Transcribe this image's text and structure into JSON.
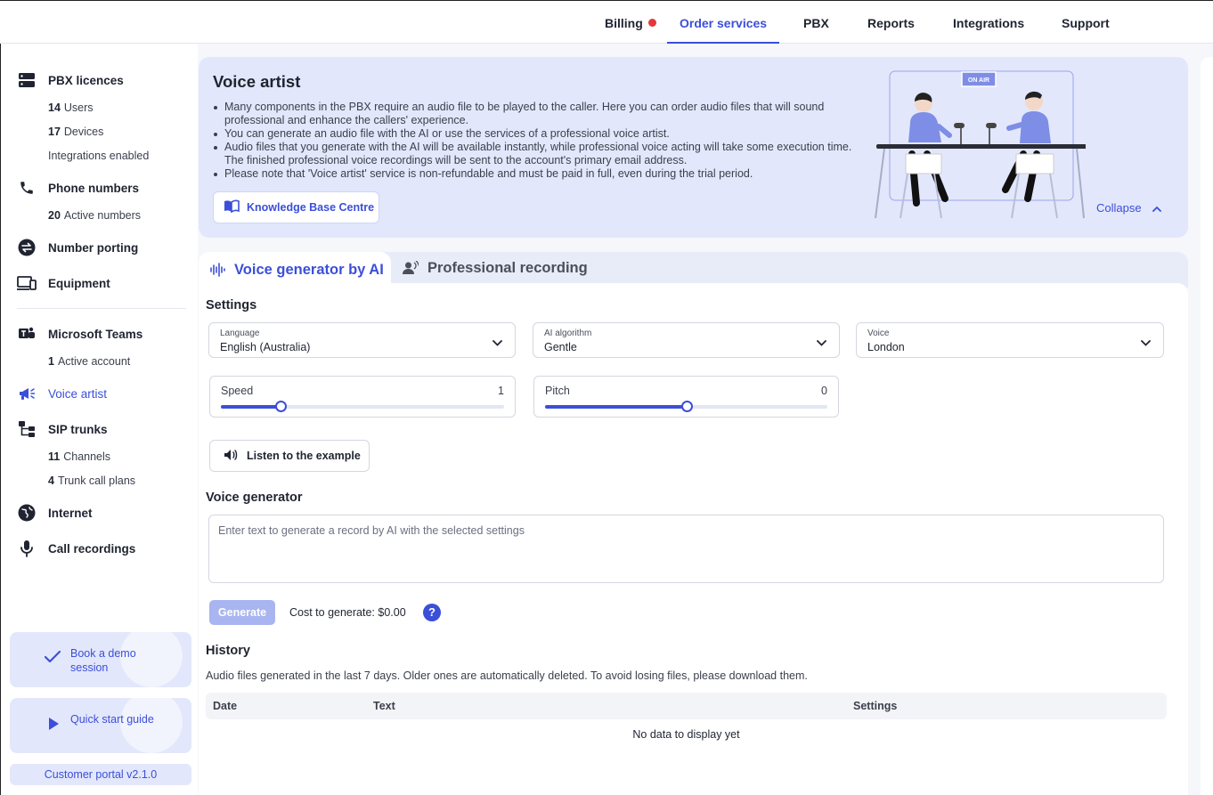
{
  "nav": {
    "items": [
      {
        "label": "Billing",
        "dot": true
      },
      {
        "label": "Order services",
        "active": true
      },
      {
        "label": "PBX"
      },
      {
        "label": "Reports"
      },
      {
        "label": "Integrations"
      },
      {
        "label": "Support"
      }
    ]
  },
  "sidebar": {
    "pbx": {
      "label": "PBX licences",
      "subs": [
        {
          "n": "14",
          "t": "Users"
        },
        {
          "n": "17",
          "t": "Devices"
        },
        {
          "n": "",
          "t": "Integrations enabled"
        }
      ]
    },
    "phone": {
      "label": "Phone numbers",
      "subs": [
        {
          "n": "20",
          "t": "Active numbers"
        }
      ]
    },
    "porting": {
      "label": "Number porting"
    },
    "equipment": {
      "label": "Equipment"
    },
    "teams": {
      "label": "Microsoft Teams",
      "subs": [
        {
          "n": "1",
          "t": "Active account"
        }
      ]
    },
    "voice": {
      "label": "Voice artist"
    },
    "sip": {
      "label": "SIP trunks",
      "subs": [
        {
          "n": "11",
          "t": "Channels"
        },
        {
          "n": "4",
          "t": "Trunk call plans"
        }
      ]
    },
    "internet": {
      "label": "Internet"
    },
    "recordings": {
      "label": "Call recordings"
    },
    "demo": "Book a demo session",
    "guide": "Quick start guide",
    "version": "Customer portal v2.1.0"
  },
  "banner": {
    "title": "Voice artist",
    "bullets": [
      "Many components in the PBX require an audio file to be played to the caller. Here you can order audio files that will sound professional and enhance the callers' experience.",
      "You can generate an audio file with the AI or use the services of a professional voice artist.",
      "Audio files that you generate with the AI will be available instantly, while professional voice acting will take some execution time. The finished professional voice recordings will be sent to the account's primary email address.",
      "Please note that 'Voice artist' service is non-refundable and must be paid in full, even during the trial period."
    ],
    "kb_button": "Knowledge Base Centre",
    "collapse": "Collapse",
    "on_air": "ON AIR"
  },
  "tabs": {
    "ai": "Voice generator by AI",
    "pro": "Professional recording"
  },
  "settings": {
    "title": "Settings",
    "language": {
      "label": "Language",
      "value": "English (Australia)"
    },
    "algorithm": {
      "label": "AI algorithm",
      "value": "Gentle"
    },
    "voice": {
      "label": "Voice",
      "value": "London"
    },
    "speed": {
      "label": "Speed",
      "value": "1",
      "level": 0.21
    },
    "pitch": {
      "label": "Pitch",
      "value": "0",
      "level": 0.5
    },
    "listen": "Listen to the example"
  },
  "generator": {
    "title": "Voice generator",
    "placeholder": "Enter text to generate a record by AI with the selected settings",
    "button": "Generate",
    "cost": "Cost to generate: $0.00",
    "help": "?"
  },
  "history": {
    "title": "History",
    "description": "Audio files generated in the last 7 days. Older ones are automatically deleted. To avoid losing files, please download them.",
    "columns": [
      "Date",
      "Text",
      "Settings"
    ],
    "empty": "No data to display yet"
  },
  "colors": {
    "accent": "#3b4fd8",
    "banner_bg": "#e3e7fb",
    "dot": "#e5383b"
  }
}
